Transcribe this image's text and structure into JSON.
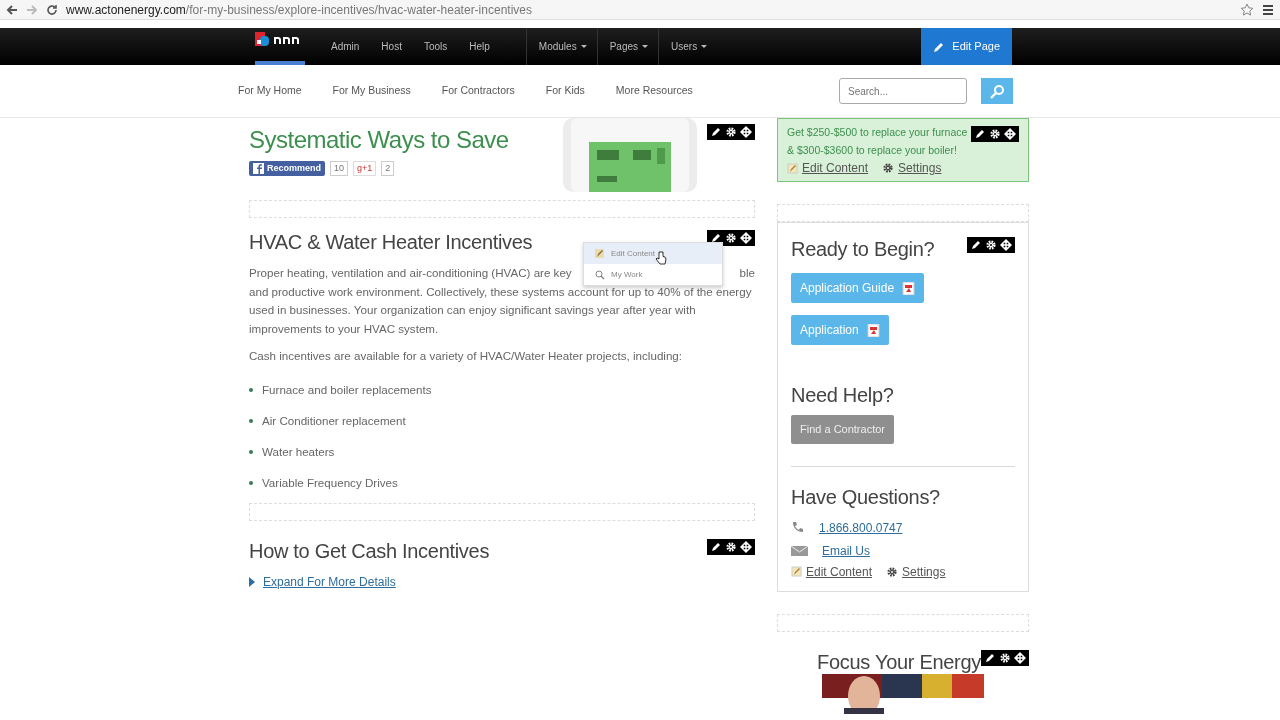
{
  "browser": {
    "url_domain": "www.actonenergy.com",
    "url_path": "/for-my-business/explore-incentives/hvac-water-heater-incentives"
  },
  "admin_bar": {
    "links": [
      "Admin",
      "Host",
      "Tools",
      "Help"
    ],
    "menus": [
      "Modules",
      "Pages",
      "Users"
    ],
    "edit_button": "Edit Page"
  },
  "nav": {
    "items": [
      "For My Home",
      "For My Business",
      "For Contractors",
      "For Kids",
      "More Resources"
    ],
    "search_placeholder": "Search..."
  },
  "main": {
    "title": "Systematic Ways to Save",
    "social": {
      "recommend": "Recommend",
      "recommend_count": "10",
      "plus_one": "g+1",
      "plus_one_count": "2"
    },
    "hvac": {
      "heading": "HVAC & Water Heater Incentives",
      "line1_start": "Proper heating, ventilation and air-conditioning (HVAC) are key",
      "line1_end": "ble",
      "paragraph_rest": "and productive work environment. Collectively, these systems account for up to 40% of the energy used in businesses. Your organization can enjoy significant savings year after year with improvements to your HVAC system.",
      "intro": "Cash incentives are available for a variety of HVAC/Water Heater projects, including:",
      "bullets": [
        "Furnace and boiler replacements",
        "Air Conditioner replacement",
        "Water heaters",
        "Variable Frequency Drives"
      ]
    },
    "context_menu": [
      {
        "label": "Edit Content",
        "selected": true
      },
      {
        "label": "My Work",
        "selected": false
      }
    ],
    "cash": {
      "heading": "How to Get Cash Incentives",
      "expand_link": "Expand For More Details"
    }
  },
  "sidebar": {
    "promo": {
      "text": "Get $250-$500 to replace your furnace & $300-$3600 to replace your boiler!",
      "edit": "Edit Content",
      "settings": "Settings"
    },
    "ready": {
      "heading": "Ready to Begin?",
      "buttons": [
        "Application Guide",
        "Application"
      ]
    },
    "help": {
      "heading": "Need Help?",
      "button": "Find a Contractor"
    },
    "questions": {
      "heading": "Have Questions?",
      "phone": "1.866.800.0747",
      "email": "Email Us",
      "edit": "Edit Content",
      "settings": "Settings"
    },
    "focus": {
      "heading": "Focus Your Energy"
    }
  }
}
